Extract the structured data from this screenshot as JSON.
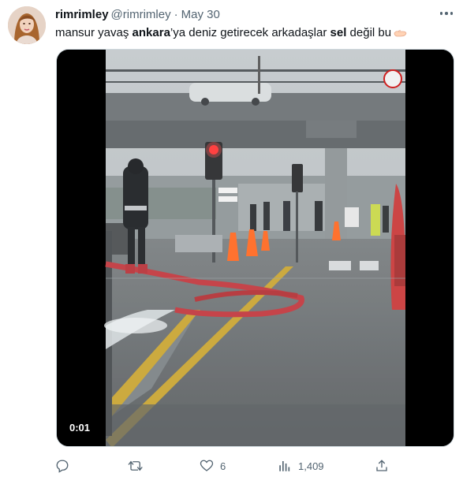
{
  "author": {
    "display_name": "rimrimley",
    "handle": "@rimrimley",
    "separator": "·",
    "date": "May 30"
  },
  "tweet": {
    "text_part1": "mansur yavaş ",
    "text_bold1": "ankara",
    "text_part2": "’ya deniz getirecek arkadaşlar ",
    "text_bold2": "sel",
    "text_part3": " değil bu",
    "emoji_icon": "palm-up-hand-icon"
  },
  "media": {
    "video_timestamp": "0:01"
  },
  "actions": {
    "reply_count": "",
    "retweet_count": "",
    "like_count": "6",
    "views_count": "1,409"
  },
  "colors": {
    "text_primary": "#0f1419",
    "text_secondary": "#536471",
    "border": "#cfd9de"
  }
}
